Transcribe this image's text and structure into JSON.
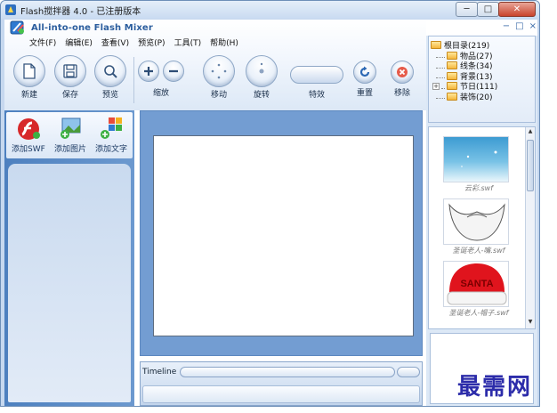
{
  "window": {
    "title": "Flash搅拌器 4.0 - 已注册版本",
    "controls": {
      "minimize": "─",
      "maximize": "□",
      "close": "✕"
    }
  },
  "app": {
    "title": "All-into-one Flash Mixer",
    "inner_controls": {
      "minimize": "−",
      "restore": "□",
      "close": "×"
    }
  },
  "menu": [
    "文件(F)",
    "编辑(E)",
    "查看(V)",
    "预览(P)",
    "工具(T)",
    "帮助(H)"
  ],
  "toolbar": {
    "new": "新建",
    "save": "保存",
    "preview": "预览",
    "zoom": "缩放",
    "move": "移动",
    "rotate": "旋转",
    "effects": "特效",
    "reset": "重置",
    "remove": "移除"
  },
  "left_tools": {
    "add_swf": "添加SWF",
    "add_image": "添加图片",
    "add_text": "添加文字"
  },
  "timeline": {
    "label": "Timeline"
  },
  "tree": {
    "root": "根目录(219)",
    "items": [
      {
        "label": "物品(27)",
        "expandable": false
      },
      {
        "label": "线条(34)",
        "expandable": false
      },
      {
        "label": "背景(13)",
        "expandable": false
      },
      {
        "label": "节日(111)",
        "expandable": true
      },
      {
        "label": "装饰(20)",
        "expandable": false
      }
    ]
  },
  "thumbnails": [
    {
      "label": "云彩.swf"
    },
    {
      "label": "圣诞老人-嘴.swf"
    },
    {
      "label": "圣诞老人-帽子.swf",
      "overlay_text": "SANTA"
    }
  ],
  "watermark": "最需网",
  "colors": {
    "accent": "#2c5e9e",
    "stage_frame": "#739dd2",
    "left_panel": "#5a8bc8",
    "close_button": "#c9432c",
    "watermark": "#2c2caa"
  }
}
